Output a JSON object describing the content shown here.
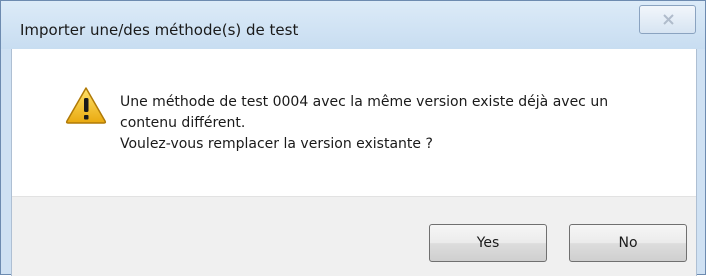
{
  "dialog": {
    "title": "Importer une/des méthode(s) de test",
    "close_icon": "close-icon",
    "warning_icon": "warning-triangle-icon",
    "message_lines": [
      "Une méthode de test 0004 avec la même version existe déjà avec un",
      "contenu différent.",
      "Voulez-vous remplacer la version existante ?"
    ],
    "buttons": {
      "yes_label": "Yes",
      "no_label": "No"
    }
  },
  "colors": {
    "frame": "#cfe1f3",
    "warning": "#f4c430",
    "footer": "#f0f0f0"
  }
}
